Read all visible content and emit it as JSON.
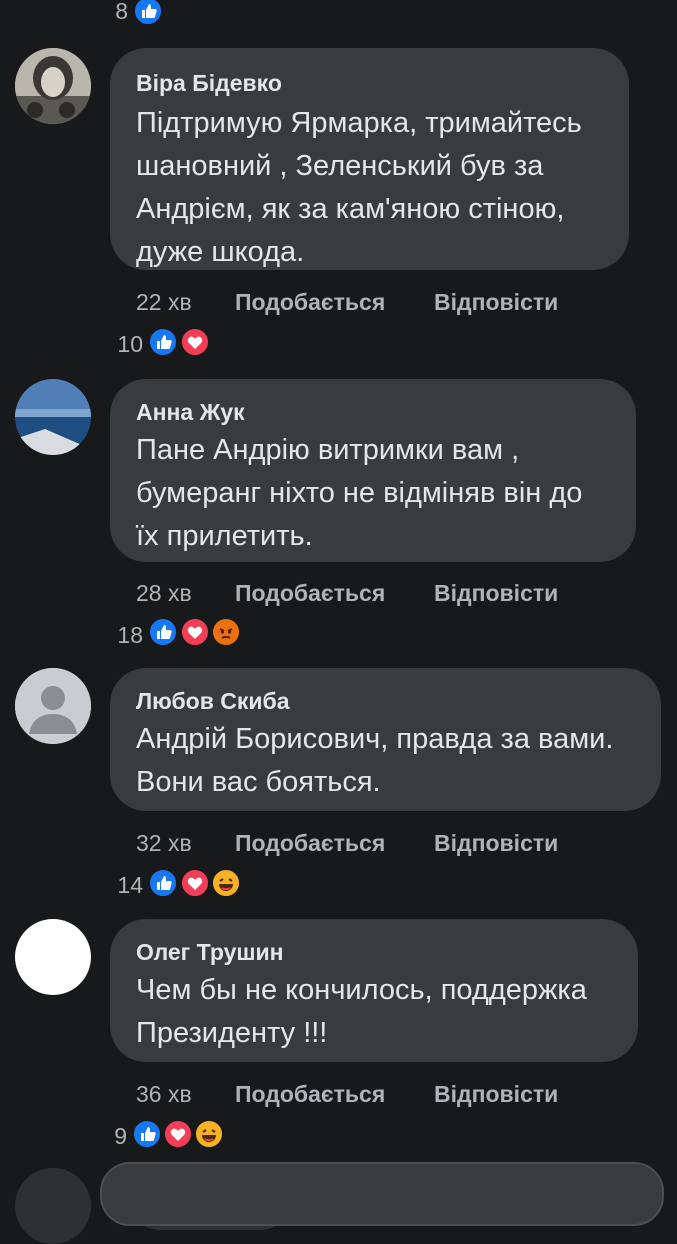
{
  "top_reaction": {
    "count": "8"
  },
  "comments": [
    {
      "author": "Віра Бідевко",
      "text": "Підтримую Ярмарка, тримайтесь\nшановний , Зеленський був за\nАндрієм, як за кам'яною стіною,\nдуже шкода.",
      "time": "22 хв",
      "like_label": "Подобається",
      "reply_label": "Відповісти",
      "reaction_count": "10",
      "reactions": [
        "like-icon",
        "love-icon"
      ]
    },
    {
      "author": "Анна Жук",
      "text": "Пане Андрію витримки вам ,\nбумеранг ніхто не відміняв він до\nїх прилетить.",
      "time": "28 хв",
      "like_label": "Подобається",
      "reply_label": "Відповісти",
      "reaction_count": "18",
      "reactions": [
        "like-icon",
        "love-icon",
        "angry-icon"
      ]
    },
    {
      "author": "Любов Скиба",
      "text": "Андрій Борисович, правда за вами.\nВони вас бояться.",
      "time": "32 хв",
      "like_label": "Подобається",
      "reply_label": "Відповісти",
      "reaction_count": "14",
      "reactions": [
        "like-icon",
        "love-icon",
        "haha-icon"
      ]
    },
    {
      "author": "Олег Трушин",
      "text": "Чем бы не кончилось, поддержка\nПрезиденту !!!",
      "time": "36 хв",
      "like_label": "Подобається",
      "reply_label": "Відповісти",
      "reaction_count": "9",
      "reactions": [
        "like-icon",
        "love-icon",
        "haha-icon"
      ]
    }
  ],
  "colors": {
    "background": "#18191a",
    "bubble": "#3a3b3c",
    "text": "#e4e6eb",
    "meta": "#b0b3b8",
    "like": "#1877f2",
    "love": "#f33e58",
    "angry": "#e9710f",
    "haha": "#f7b125"
  }
}
